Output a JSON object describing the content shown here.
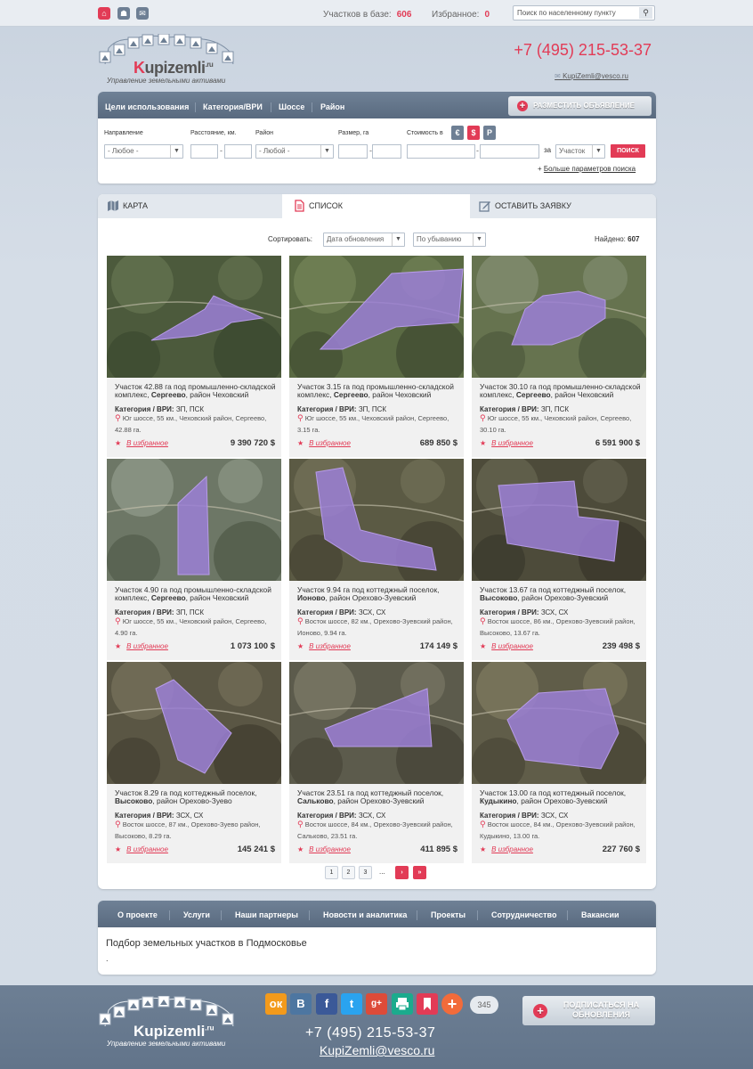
{
  "topbar": {
    "stat_label": "Участков в базе:",
    "stat_value": "606",
    "fav_label": "Избранное:",
    "fav_value": "0",
    "search_placeholder": "Поиск по населенному пункту"
  },
  "header": {
    "logo_prefix": "K",
    "logo_rest": "upizemli",
    "logo_sup": ".ru",
    "tagline": "Управление земельными активами",
    "phone": "+7 (495) 215-53-37",
    "email": "KupiZemli@vesco.ru"
  },
  "nav": {
    "items": [
      "Цели использования",
      "Категория/ВРИ",
      "Шоссе",
      "Район"
    ],
    "post_button": "РАЗМЕСТИТЬ ОБЪЯВЛЕНИЕ"
  },
  "filters": {
    "direction_label": "Направление",
    "direction_value": "- Любое -",
    "distance_label": "Расстояние, км.",
    "district_label": "Район",
    "district_value": "- Любой -",
    "size_label": "Размер, га",
    "price_label": "Стоимость в",
    "currencies": [
      "€",
      "$",
      "Р"
    ],
    "for_label": "за",
    "per_value": "Участок",
    "search_button": "ПОИСК",
    "more_label": "Больше параметров поиска"
  },
  "tabs": [
    "КАРТА",
    "СПИСОК",
    "ОСТАВИТЬ ЗАЯВКУ"
  ],
  "listing": {
    "sort_label": "Сортировать:",
    "sort_by": "Дата обновления",
    "sort_order": "По убыванию",
    "found_label": "Найдено:",
    "found_value": "607",
    "fav_link": "В избранное",
    "cat_label": "Категория / ВРИ:"
  },
  "cards": [
    {
      "title_a": "Участок 42.88 га под промышленно-складской комплекс, ",
      "place": "Сергеево",
      "title_b": ", район Чеховский",
      "cat": "ЗП, ПСК",
      "loc": "Юг шоссе, 55 км., Чеховский район, Сергеево, 42.88 га.",
      "price": "9 390 720 $"
    },
    {
      "title_a": "Участок 3.15 га под промышленно-складской комплекс, ",
      "place": "Сергеево",
      "title_b": ", район Чеховский",
      "cat": "ЗП, ПСК",
      "loc": "Юг шоссе, 55 км., Чеховский район, Сергеево, 3.15 га.",
      "price": "689 850 $"
    },
    {
      "title_a": "Участок 30.10 га под промышленно-складской комплекс, ",
      "place": "Сергеево",
      "title_b": ", район Чеховский",
      "cat": "ЗП, ПСК",
      "loc": "Юг шоссе, 55 км., Чеховский район, Сергеево, 30.10 га.",
      "price": "6 591 900 $"
    },
    {
      "title_a": "Участок 4.90 га под промышленно-складской комплекс, ",
      "place": "Сергеево",
      "title_b": ", район Чеховский",
      "cat": "ЗП, ПСК",
      "loc": "Юг шоссе, 55 км., Чеховский район, Сергеево, 4.90 га.",
      "price": "1 073 100 $"
    },
    {
      "title_a": "Участок 9.94 га под коттеджный поселок, ",
      "place": "Ионово",
      "title_b": ", район Орехово-Зуевский",
      "cat": "ЗСХ, СХ",
      "loc": "Восток шоссе, 82 км., Орехово-Зуевский район, Ионово, 9.94 га.",
      "price": "174 149 $"
    },
    {
      "title_a": "Участок 13.67 га под коттеджный поселок, ",
      "place": "Высоково",
      "title_b": ", район Орехово-Зуевский",
      "cat": "ЗСХ, СХ",
      "loc": "Восток шоссе, 86 км., Орехово-Зуевский район, Высоково, 13.67 га.",
      "price": "239 498 $"
    },
    {
      "title_a": "Участок 8.29 га под коттеджный поселок, ",
      "place": "Высоково",
      "title_b": ", район Орехово-Зуево",
      "cat": "ЗСХ, СХ",
      "loc": "Восток шоссе, 87 км., Орехово-Зуево район, Высоково, 8.29 га.",
      "price": "145 241 $"
    },
    {
      "title_a": "Участок 23.51 га под коттеджный поселок, ",
      "place": "Сальково",
      "title_b": ", район Орехово-Зуевский",
      "cat": "ЗСХ, СХ",
      "loc": "Восток шоссе, 84 км., Орехово-Зуевский район, Сальково, 23.51 га.",
      "price": "411 895 $"
    },
    {
      "title_a": "Участок 13.00 га под коттеджный поселок, ",
      "place": "Кудыкино",
      "title_b": ", район Орехово-Зуевский",
      "cat": "ЗСХ, СХ",
      "loc": "Восток шоссе, 84 км., Орехово-Зуевский район, Кудыкино, 13.00 га.",
      "price": "227 760 $"
    }
  ],
  "pagination": [
    "1",
    "2",
    "3",
    "...",
    "›",
    "»"
  ],
  "footer_nav": [
    "О проекте",
    "Услуги",
    "Наши партнеры",
    "Новости и аналитика",
    "Проекты",
    "Сотрудничество",
    "Вакансии"
  ],
  "footer_text": {
    "heading": "Подбор земельных участков в Подмосковье",
    "dot": "."
  },
  "social": {
    "count": "345",
    "subscribe": "ПОДПИСАТЬСЯ НА ОБНОВЛЕНИЯ",
    "icons": [
      "ок",
      "В",
      "f",
      "t",
      "g+",
      "print",
      "bookmark",
      "+"
    ]
  },
  "colors": {
    "accent": "#e23b56",
    "nav": "#62748a",
    "plot": "#9b7fd6"
  }
}
